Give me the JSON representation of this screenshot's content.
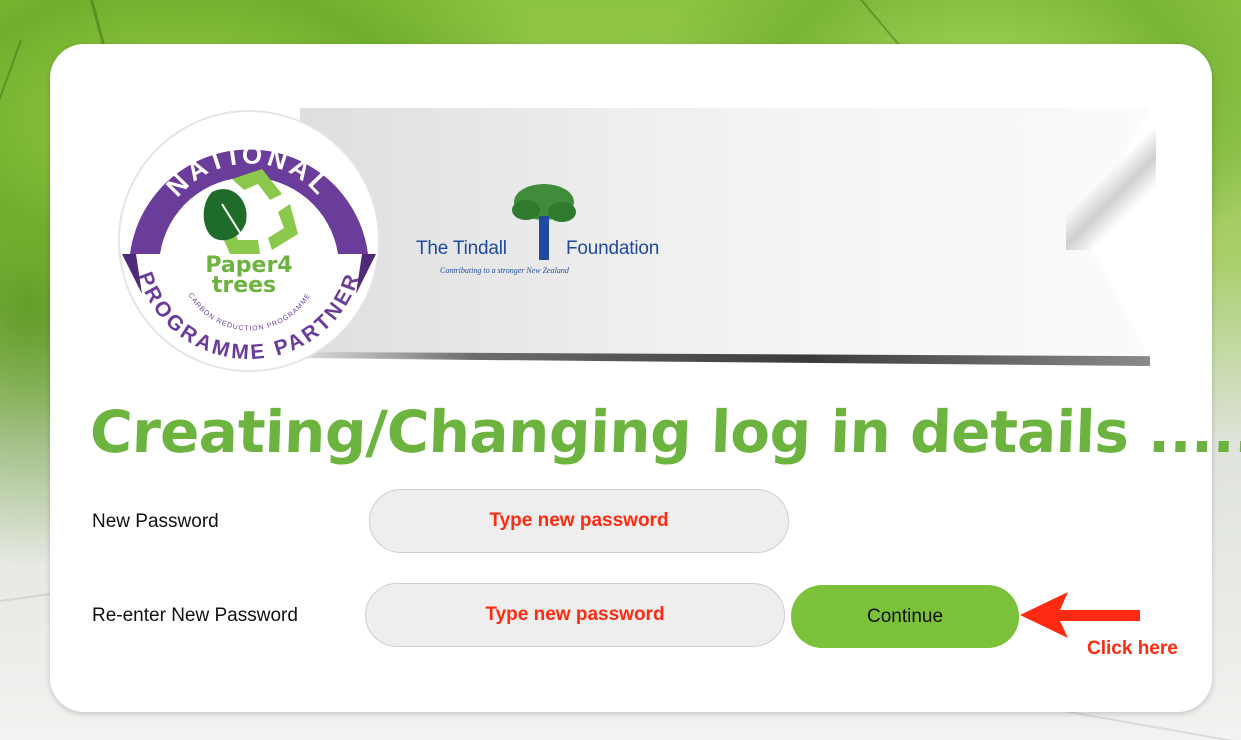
{
  "badge": {
    "top_text": "NATIONAL",
    "bottom_text": "PROGRAMME PARTNER",
    "brand_line1": "Paper4",
    "brand_line2": "trees",
    "small_text": "CARBON REDUCTION PROGRAMME"
  },
  "sponsor": {
    "name_left": "The Tindall",
    "name_right": "Foundation",
    "tagline": "Contributing to a stronger New Zealand"
  },
  "heading": "Creating/Changing log in details ......",
  "form": {
    "new_password_label": "New Password",
    "new_password_placeholder": "Type new password",
    "reenter_label": "Re-enter New Password",
    "reenter_placeholder": "Type new password",
    "continue_label": "Continue"
  },
  "annotation": {
    "text": "Click here",
    "color": "#ff2a12"
  },
  "colors": {
    "brand_green": "#6db33f",
    "button_green": "#7bc23a",
    "badge_purple": "#6a3d9a",
    "sponsor_blue": "#1f4aa0"
  }
}
